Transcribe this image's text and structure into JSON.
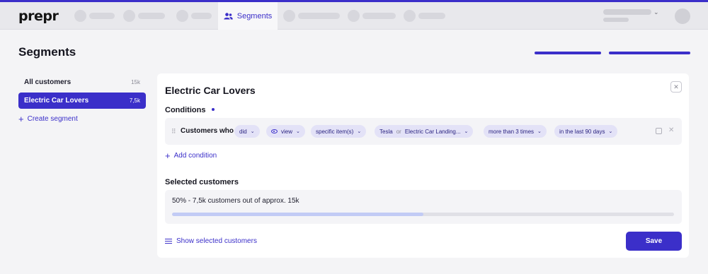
{
  "brand": {
    "logo": "prepr",
    "accent": "#3b2fc9"
  },
  "nav": {
    "active_label": "Segments",
    "active_icon": "users-icon"
  },
  "page": {
    "title": "Segments"
  },
  "sidebar": {
    "items": [
      {
        "label": "All customers",
        "count": "15k"
      },
      {
        "label": "Electric Car Lovers",
        "count": "7,5k"
      }
    ],
    "create_label": "Create segment"
  },
  "segment": {
    "title": "Electric Car Lovers",
    "conditions_label": "Conditions",
    "condition": {
      "lead": "Customers who",
      "chips": {
        "did": "did",
        "action": "view",
        "item_type": "specific item(s)",
        "item1": "Tesla",
        "or": "or",
        "item2": "Electric Car Landing...",
        "frequency": "more than 3 times",
        "period": "in the last 90 days"
      }
    },
    "add_condition_label": "Add condition",
    "selected_label": "Selected customers",
    "selected_summary": "50% - 7,5k customers out of approx. 15k",
    "selected_fraction": 0.5,
    "show_selected_label": "Show selected customers",
    "save_label": "Save"
  }
}
